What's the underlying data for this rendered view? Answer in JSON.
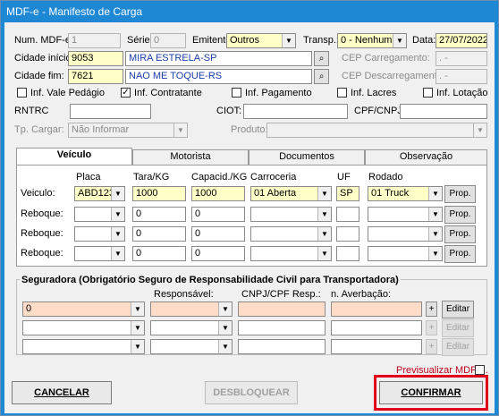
{
  "window": {
    "title": "MDF-e - Manifesto de Carga"
  },
  "header": {
    "num_label": "Num. MDF-e:",
    "num_value": "1",
    "serie_label": "Série:",
    "serie_value": "0",
    "emitente_label": "Emitente:",
    "emitente_value": "Outros",
    "transp_label": "Transp.:",
    "transp_value": "0 - Nenhum",
    "data_label": "Data:",
    "data_value": "27/07/2022"
  },
  "origin": {
    "cidade_inicio_label": "Cidade início:",
    "cidade_inicio_code": "9053",
    "cidade_inicio_name": "MIRA ESTRELA-SP",
    "cidade_fim_label": "Cidade fim:",
    "cidade_fim_code": "7621",
    "cidade_fim_name": "NAO ME TOQUE-RS",
    "cep_carregamento_label": "CEP Carregamento:",
    "cep_carregamento_value": ".   -",
    "cep_descarregamento_label": "CEP Descarregamento:",
    "cep_descarregamento_value": ".   -"
  },
  "checks": [
    {
      "label": "Inf. Vale Pedágio",
      "checked": ""
    },
    {
      "label": "Inf. Contratante",
      "checked": "✓"
    },
    {
      "label": "Inf. Pagamento",
      "checked": ""
    },
    {
      "label": "Inf. Lacres",
      "checked": ""
    },
    {
      "label": "Inf. Lotação",
      "checked": ""
    }
  ],
  "misc": {
    "rntrc_label": "RNTRC",
    "ciot_label": "CIOT:",
    "cpf_cnpj_label": "CPF/CNPJ:",
    "tp_cargar_label": "Tp. Cargar:",
    "tp_cargar_value": "Não Informar",
    "produto_label": "Produto:"
  },
  "tabs": [
    {
      "label": "Veículo"
    },
    {
      "label": "Motorista"
    },
    {
      "label": "Documentos"
    },
    {
      "label": "Observação"
    }
  ],
  "vehicle": {
    "col_placa": "Placa",
    "col_tara": "Tara/KG",
    "col_capacid": "Capacid./KG",
    "col_carroceria": "Carroceria",
    "col_uf": "UF",
    "col_rodado": "Rodado",
    "rows": [
      {
        "label": "Veiculo:",
        "placa": "ABD1234",
        "tara": "1000",
        "capacid": "1000",
        "carroceria": "01 Aberta",
        "uf": "SP",
        "rodado": "01 Truck",
        "btn": "Prop."
      },
      {
        "label": "Reboque:",
        "placa": "",
        "tara": "0",
        "capacid": "0",
        "carroceria": "",
        "uf": "",
        "rodado": "",
        "btn": "Prop."
      },
      {
        "label": "Reboque:",
        "placa": "",
        "tara": "0",
        "capacid": "0",
        "carroceria": "",
        "uf": "",
        "rodado": "",
        "btn": "Prop."
      },
      {
        "label": "Reboque:",
        "placa": "",
        "tara": "0",
        "capacid": "0",
        "carroceria": "",
        "uf": "",
        "rodado": "",
        "btn": "Prop."
      }
    ]
  },
  "insurance": {
    "title": "Seguradora (Obrigatório Seguro de Responsabilidade Civil para Transportadora)",
    "col_responsavel": "Responsável:",
    "col_cnpj": "CNPJ/CPF Resp.:",
    "col_averbacao": "n. Averbação:",
    "rows": [
      {
        "seguradora": "0",
        "plus": "+",
        "btn": "Editar"
      },
      {
        "seguradora": "",
        "plus": "+",
        "btn": "Editar"
      },
      {
        "seguradora": "",
        "plus": "+",
        "btn": "Editar"
      }
    ]
  },
  "footer": {
    "previsualizar_label": "Previsualizar MDF-e.",
    "cancelar": "CANCELAR",
    "desbloquear": "DESBLOQUEAR",
    "confirmar": "CONFIRMAR",
    "highlight_color": "#e0001b"
  }
}
